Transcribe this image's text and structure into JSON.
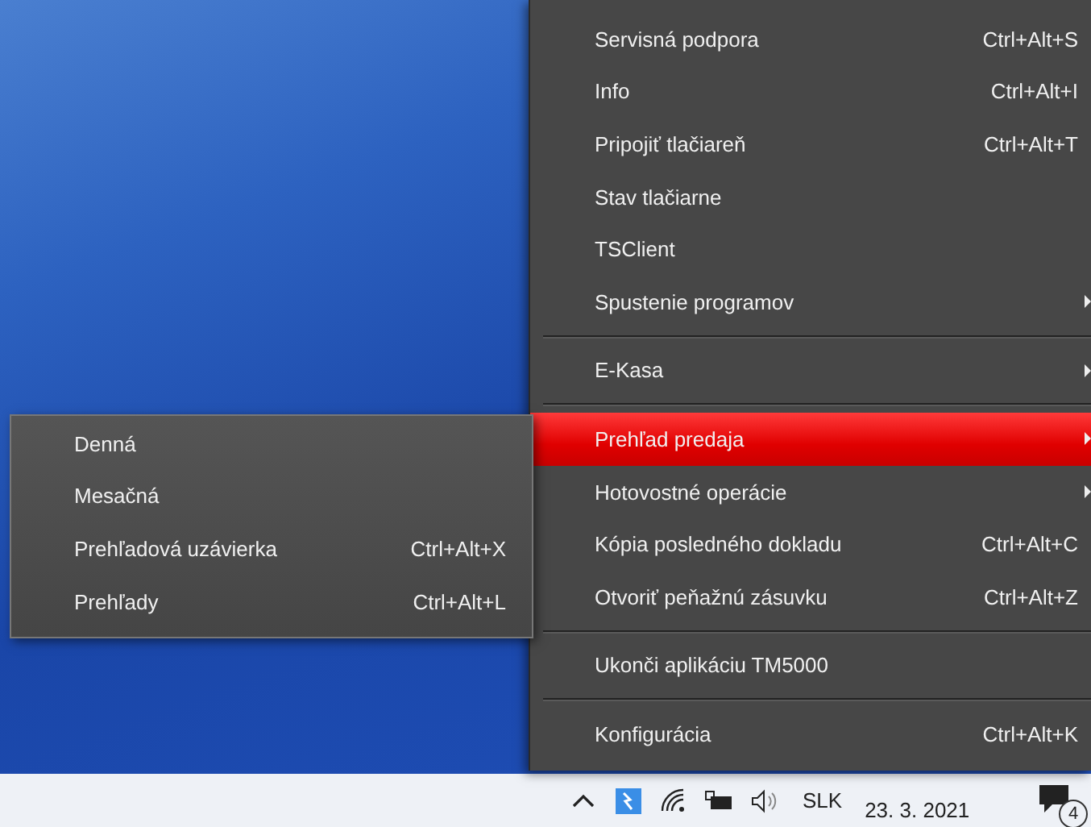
{
  "menu": {
    "sections": [
      [
        {
          "label": "Servisná podpora",
          "shortcut": "Ctrl+Alt+S",
          "submenu": false,
          "selected": false
        },
        {
          "label": "Info",
          "shortcut": "Ctrl+Alt+I",
          "submenu": false,
          "selected": false
        },
        {
          "label": "Pripojiť tlačiareň",
          "shortcut": "Ctrl+Alt+T",
          "submenu": false,
          "selected": false
        },
        {
          "label": "Stav tlačiarne",
          "submenu": false,
          "selected": false
        },
        {
          "label": "TSClient",
          "submenu": false,
          "selected": false
        },
        {
          "label": "Spustenie programov",
          "submenu": true,
          "selected": false
        }
      ],
      [
        {
          "label": "E-Kasa",
          "submenu": true,
          "selected": false
        }
      ],
      [
        {
          "label": "Prehľad predaja",
          "submenu": true,
          "selected": true
        },
        {
          "label": "Hotovostné operácie",
          "submenu": true,
          "selected": false
        },
        {
          "label": "Kópia posledného dokladu",
          "shortcut": "Ctrl+Alt+C",
          "submenu": false,
          "selected": false
        },
        {
          "label": "Otvoriť peňažnú zásuvku",
          "shortcut": "Ctrl+Alt+Z",
          "submenu": false,
          "selected": false
        }
      ],
      [
        {
          "label": "Ukonči aplikáciu TM5000",
          "submenu": false,
          "selected": false
        }
      ],
      [
        {
          "label": "Konfigurácia",
          "shortcut": "Ctrl+Alt+K",
          "submenu": false,
          "selected": false
        }
      ]
    ]
  },
  "submenu": {
    "items": [
      {
        "label": "Denná"
      },
      {
        "label": "Mesačná"
      },
      {
        "label": "Prehľadová uzávierka",
        "shortcut": "Ctrl+Alt+X"
      },
      {
        "label": "Prehľady",
        "shortcut": "Ctrl+Alt+L"
      }
    ]
  },
  "taskbar": {
    "language": "SLK",
    "date": "23. 3. 2021",
    "notifications": "4"
  }
}
